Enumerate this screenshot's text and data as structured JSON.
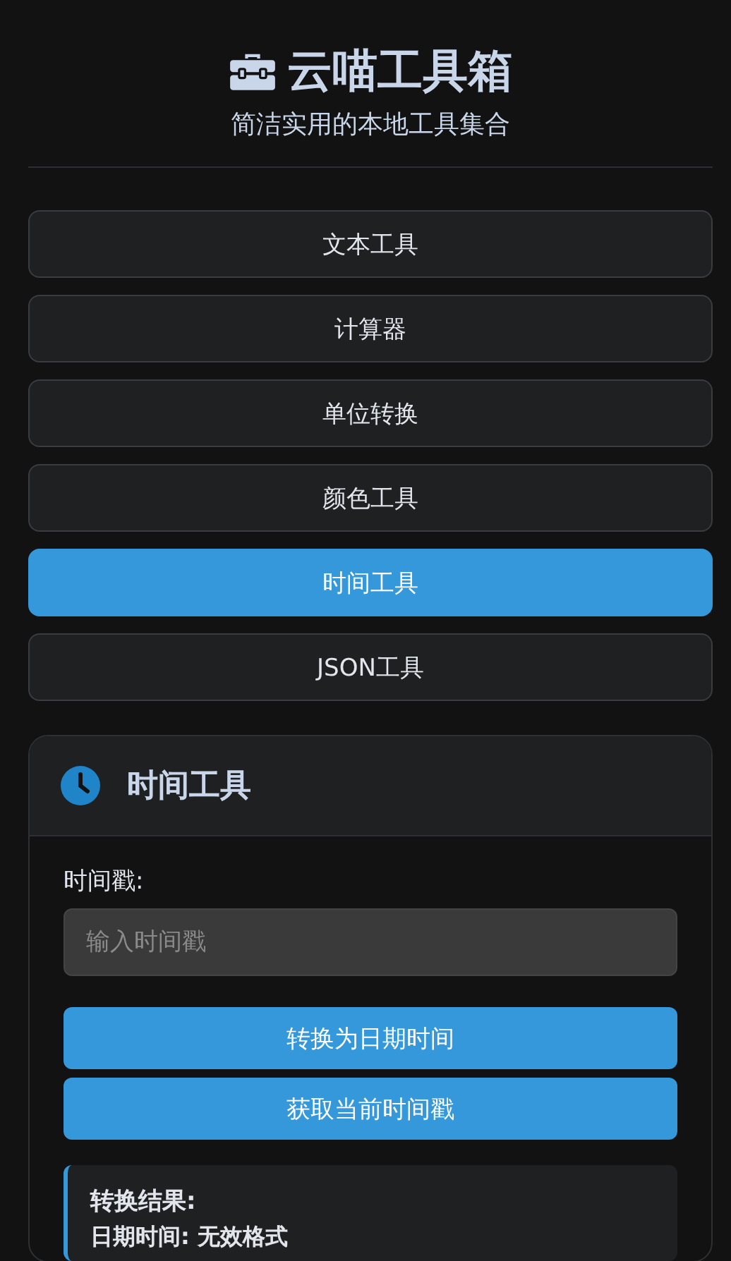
{
  "header": {
    "title": "云喵工具箱",
    "subtitle": "简洁实用的本地工具集合"
  },
  "nav": [
    {
      "label": "文本工具",
      "selected": false
    },
    {
      "label": "计算器",
      "selected": false
    },
    {
      "label": "单位转换",
      "selected": false
    },
    {
      "label": "颜色工具",
      "selected": false
    },
    {
      "label": "时间工具",
      "selected": true
    },
    {
      "label": "JSON工具",
      "selected": false
    }
  ],
  "panel": {
    "title": "时间工具",
    "field_label": "时间戳:",
    "input": {
      "placeholder": "输入时间戳"
    },
    "buttons": [
      "转换为日期时间",
      "获取当前时间戳"
    ],
    "result": {
      "title": "转换结果:",
      "line": "日期时间: 无效格式"
    }
  }
}
